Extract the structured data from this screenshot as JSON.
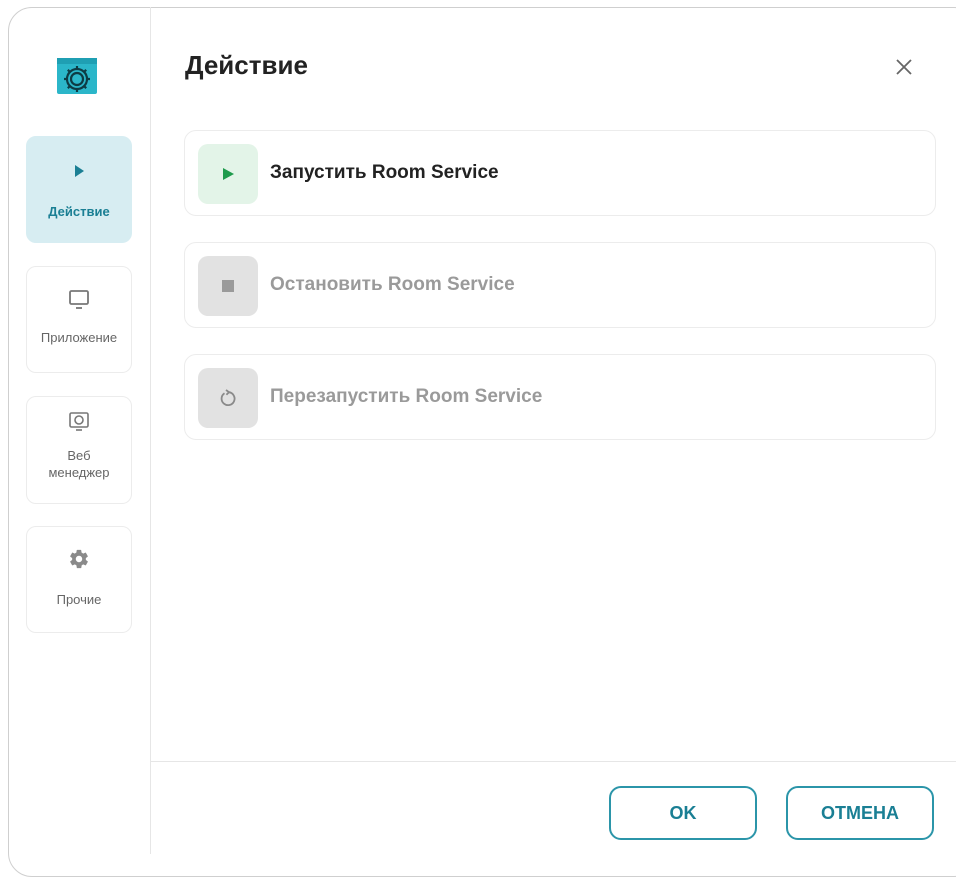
{
  "dialog": {
    "title": "Действие"
  },
  "sidebar": {
    "items": [
      {
        "label": "Действие",
        "icon": "play-icon",
        "active": true
      },
      {
        "label": "Приложение",
        "icon": "monitor-icon",
        "active": false
      },
      {
        "label": "Веб менеджер",
        "icon": "web-manager-icon",
        "active": false
      },
      {
        "label": "Прочие",
        "icon": "gear-icon",
        "active": false
      }
    ]
  },
  "actions": [
    {
      "label": "Запустить Room Service",
      "icon": "play-icon",
      "enabled": true
    },
    {
      "label": "Остановить Room Service",
      "icon": "stop-icon",
      "enabled": false
    },
    {
      "label": "Перезапустить Room Service",
      "icon": "restart-icon",
      "enabled": false
    }
  ],
  "footer": {
    "ok_label": "OK",
    "cancel_label": "ОТМЕНА"
  },
  "colors": {
    "accent": "#2b95a9",
    "active_bg": "#d7edf2",
    "start_bg": "#e3f4e8",
    "start_icon": "#1e9b4c",
    "disabled_bg": "#e2e2e2",
    "disabled_text": "#9a9a9a"
  }
}
